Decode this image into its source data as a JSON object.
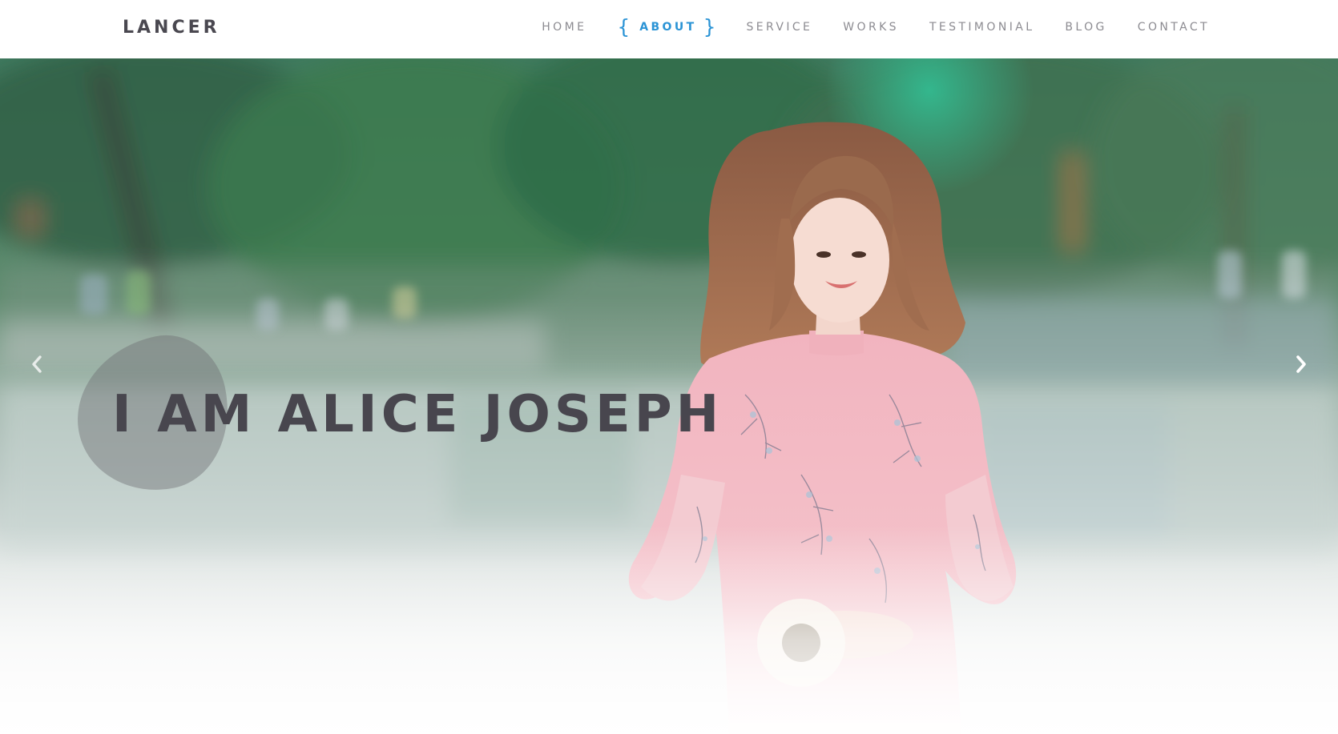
{
  "header": {
    "brand": "LANCER",
    "nav": [
      {
        "label": "HOME",
        "active": false
      },
      {
        "label": "ABOUT",
        "active": true
      },
      {
        "label": "SERVICE",
        "active": false
      },
      {
        "label": "WORKS",
        "active": false
      },
      {
        "label": "TESTIMONIAL",
        "active": false
      },
      {
        "label": "BLOG",
        "active": false
      },
      {
        "label": "CONTACT",
        "active": false
      }
    ],
    "active_braces": {
      "open": "{",
      "close": "}"
    }
  },
  "hero": {
    "title": "I AM ALICE JOSEPH",
    "prev_icon": "chevron-left-icon",
    "next_icon": "chevron-right-icon"
  },
  "colors": {
    "brand_text": "#4a4850",
    "nav_text": "#8c8b91",
    "accent": "#2a93d5",
    "hero_title": "#48464e"
  }
}
